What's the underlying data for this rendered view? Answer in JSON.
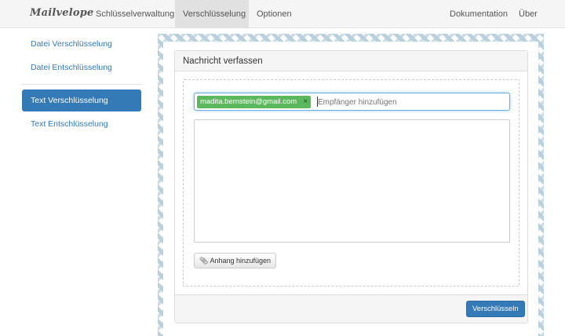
{
  "navbar": {
    "brand": "Mailvelope",
    "items": [
      {
        "label": "Schlüsselverwaltung"
      },
      {
        "label": "Verschlüsselung",
        "active": true
      },
      {
        "label": "Optionen"
      }
    ],
    "right_items": [
      {
        "label": "Dokumentation"
      },
      {
        "label": "Über"
      }
    ]
  },
  "sidebar": {
    "items": [
      {
        "label": "Datei Verschlüsselung"
      },
      {
        "label": "Datei Entschlüsselung"
      },
      {
        "label": "Text Verschlüsselung",
        "active": true
      },
      {
        "label": "Text Entschlüsselung"
      }
    ]
  },
  "compose": {
    "title": "Nachricht verfassen",
    "recipient_tag": "madita.bernstein@gmail.com",
    "recipient_remove": "×",
    "recipient_placeholder": "Empfänger hinzufügen",
    "message_value": "",
    "attach_label": "Anhang hinzufügen",
    "encrypt_label": "Verschlüsseln"
  },
  "icons": {
    "clip": "paperclip-icon"
  },
  "colors": {
    "primary": "#337ab7",
    "tag": "#5cb85c",
    "pattern": "#b9d1df"
  }
}
